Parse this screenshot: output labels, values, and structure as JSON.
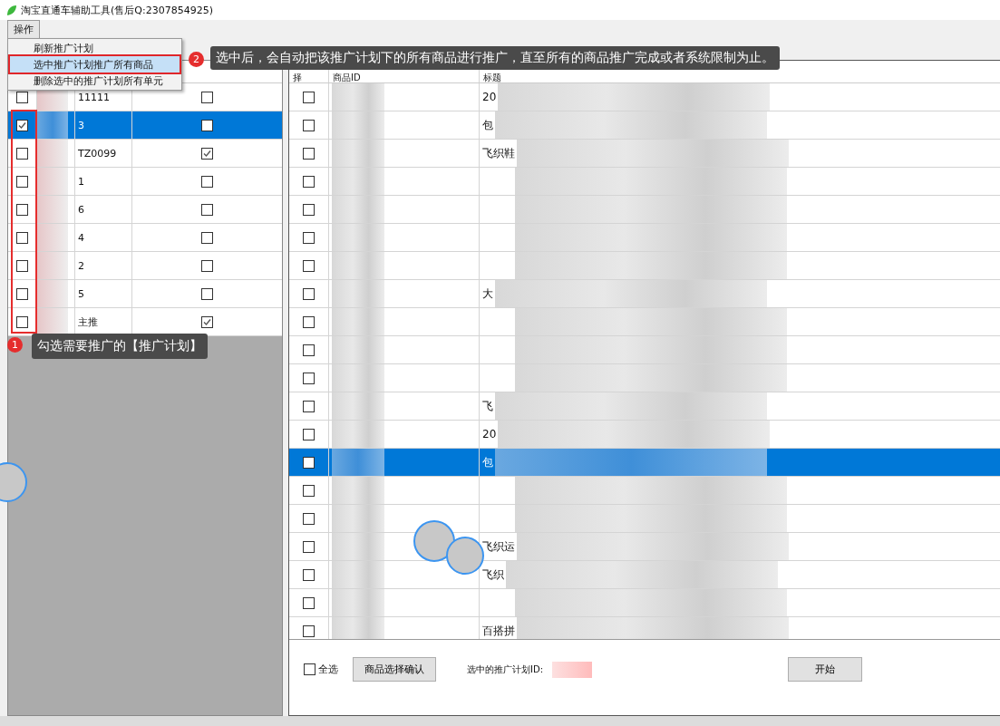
{
  "window": {
    "title": "淘宝直通车辅助工具(售后Q:2307854925)"
  },
  "menu_bar": [
    {
      "label": "操作",
      "expanded": true
    }
  ],
  "menu": {
    "items": [
      {
        "label": "刷新推广计划",
        "selected": false
      },
      {
        "label": "选中推广计划推广所有商品",
        "selected": true
      },
      {
        "label": "删除选中的推广计划所有单元",
        "selected": false
      }
    ]
  },
  "plans_table": {
    "rows": [
      {
        "checked": false,
        "name": "11111",
        "flag": false,
        "selected": false
      },
      {
        "checked": true,
        "name": "3",
        "flag": false,
        "selected": true
      },
      {
        "checked": false,
        "name": "TZ0099",
        "flag": true,
        "selected": false
      },
      {
        "checked": false,
        "name": "1",
        "flag": false,
        "selected": false
      },
      {
        "checked": false,
        "name": "6",
        "flag": false,
        "selected": false
      },
      {
        "checked": false,
        "name": "4",
        "flag": false,
        "selected": false
      },
      {
        "checked": false,
        "name": "2",
        "flag": false,
        "selected": false
      },
      {
        "checked": false,
        "name": "5",
        "flag": false,
        "selected": false
      },
      {
        "checked": false,
        "name": "主推",
        "flag": true,
        "selected": false
      }
    ]
  },
  "products_table": {
    "columns": [
      "择",
      "商品ID",
      "标题"
    ],
    "rows": [
      {
        "checked": false,
        "selected": false,
        "title": "20"
      },
      {
        "checked": false,
        "selected": false,
        "title": "包"
      },
      {
        "checked": false,
        "selected": false,
        "title": "飞织鞋"
      },
      {
        "checked": false,
        "selected": false
      },
      {
        "checked": false,
        "selected": false
      },
      {
        "checked": false,
        "selected": false
      },
      {
        "checked": false,
        "selected": false
      },
      {
        "checked": false,
        "selected": false,
        "title": "大"
      },
      {
        "checked": false,
        "selected": false
      },
      {
        "checked": false,
        "selected": false
      },
      {
        "checked": false,
        "selected": false
      },
      {
        "checked": false,
        "selected": false,
        "title": "飞"
      },
      {
        "checked": false,
        "selected": false,
        "title": "20"
      },
      {
        "checked": false,
        "selected": true,
        "title": "包"
      },
      {
        "checked": false,
        "selected": false
      },
      {
        "checked": false,
        "selected": false
      },
      {
        "checked": false,
        "selected": false,
        "title": "飞织运"
      },
      {
        "checked": false,
        "selected": false,
        "title": "飞织"
      },
      {
        "checked": false,
        "selected": false
      },
      {
        "checked": false,
        "selected": false,
        "title": "百搭拼"
      }
    ]
  },
  "footer": {
    "select_all": {
      "label": "全选",
      "checked": false
    },
    "confirm_button": "商品选择确认",
    "plan_id_label": "选中的推广计划ID:",
    "start_button": "开始"
  },
  "annotations": [
    {
      "number": "1",
      "text": "勾选需要推广的【推广计划】"
    },
    {
      "number": "2",
      "text": "选中后，会自动把该推广计划下的所有商品进行推广，直至所有的商品推广完成或者系统限制为止。"
    }
  ]
}
